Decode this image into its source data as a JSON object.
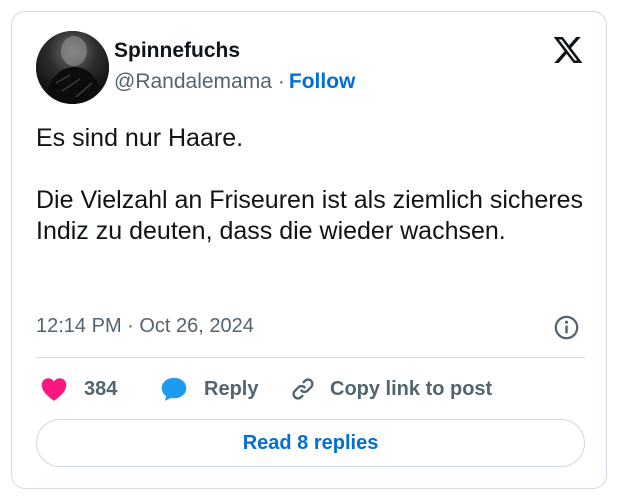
{
  "author": {
    "display_name": "Spinnefuchs",
    "handle": "@Randalemama",
    "separator": "·",
    "follow_label": "Follow"
  },
  "tweet": {
    "paragraphs": [
      "Es sind nur Haare.",
      "Die Vielzahl an Friseuren ist als ziemlich sicheres Indiz zu deuten, dass die wieder wachsen."
    ],
    "timestamp": "12:14 PM · Oct 26, 2024"
  },
  "actions": {
    "like_count": "384",
    "reply_label": "Reply",
    "copy_link_label": "Copy link to post"
  },
  "footer": {
    "read_replies_label": "Read 8 replies"
  },
  "icons": {
    "brand": "x-logo-icon",
    "info": "info-icon",
    "like": "heart-icon",
    "reply": "speech-bubble-icon",
    "copy": "link-icon"
  },
  "colors": {
    "link_blue": "#006fd6",
    "heart_pink": "#f91880",
    "reply_blue": "#1d9bf0",
    "muted_gray": "#536471",
    "border": "#cfd9de",
    "text": "#0f1419"
  }
}
